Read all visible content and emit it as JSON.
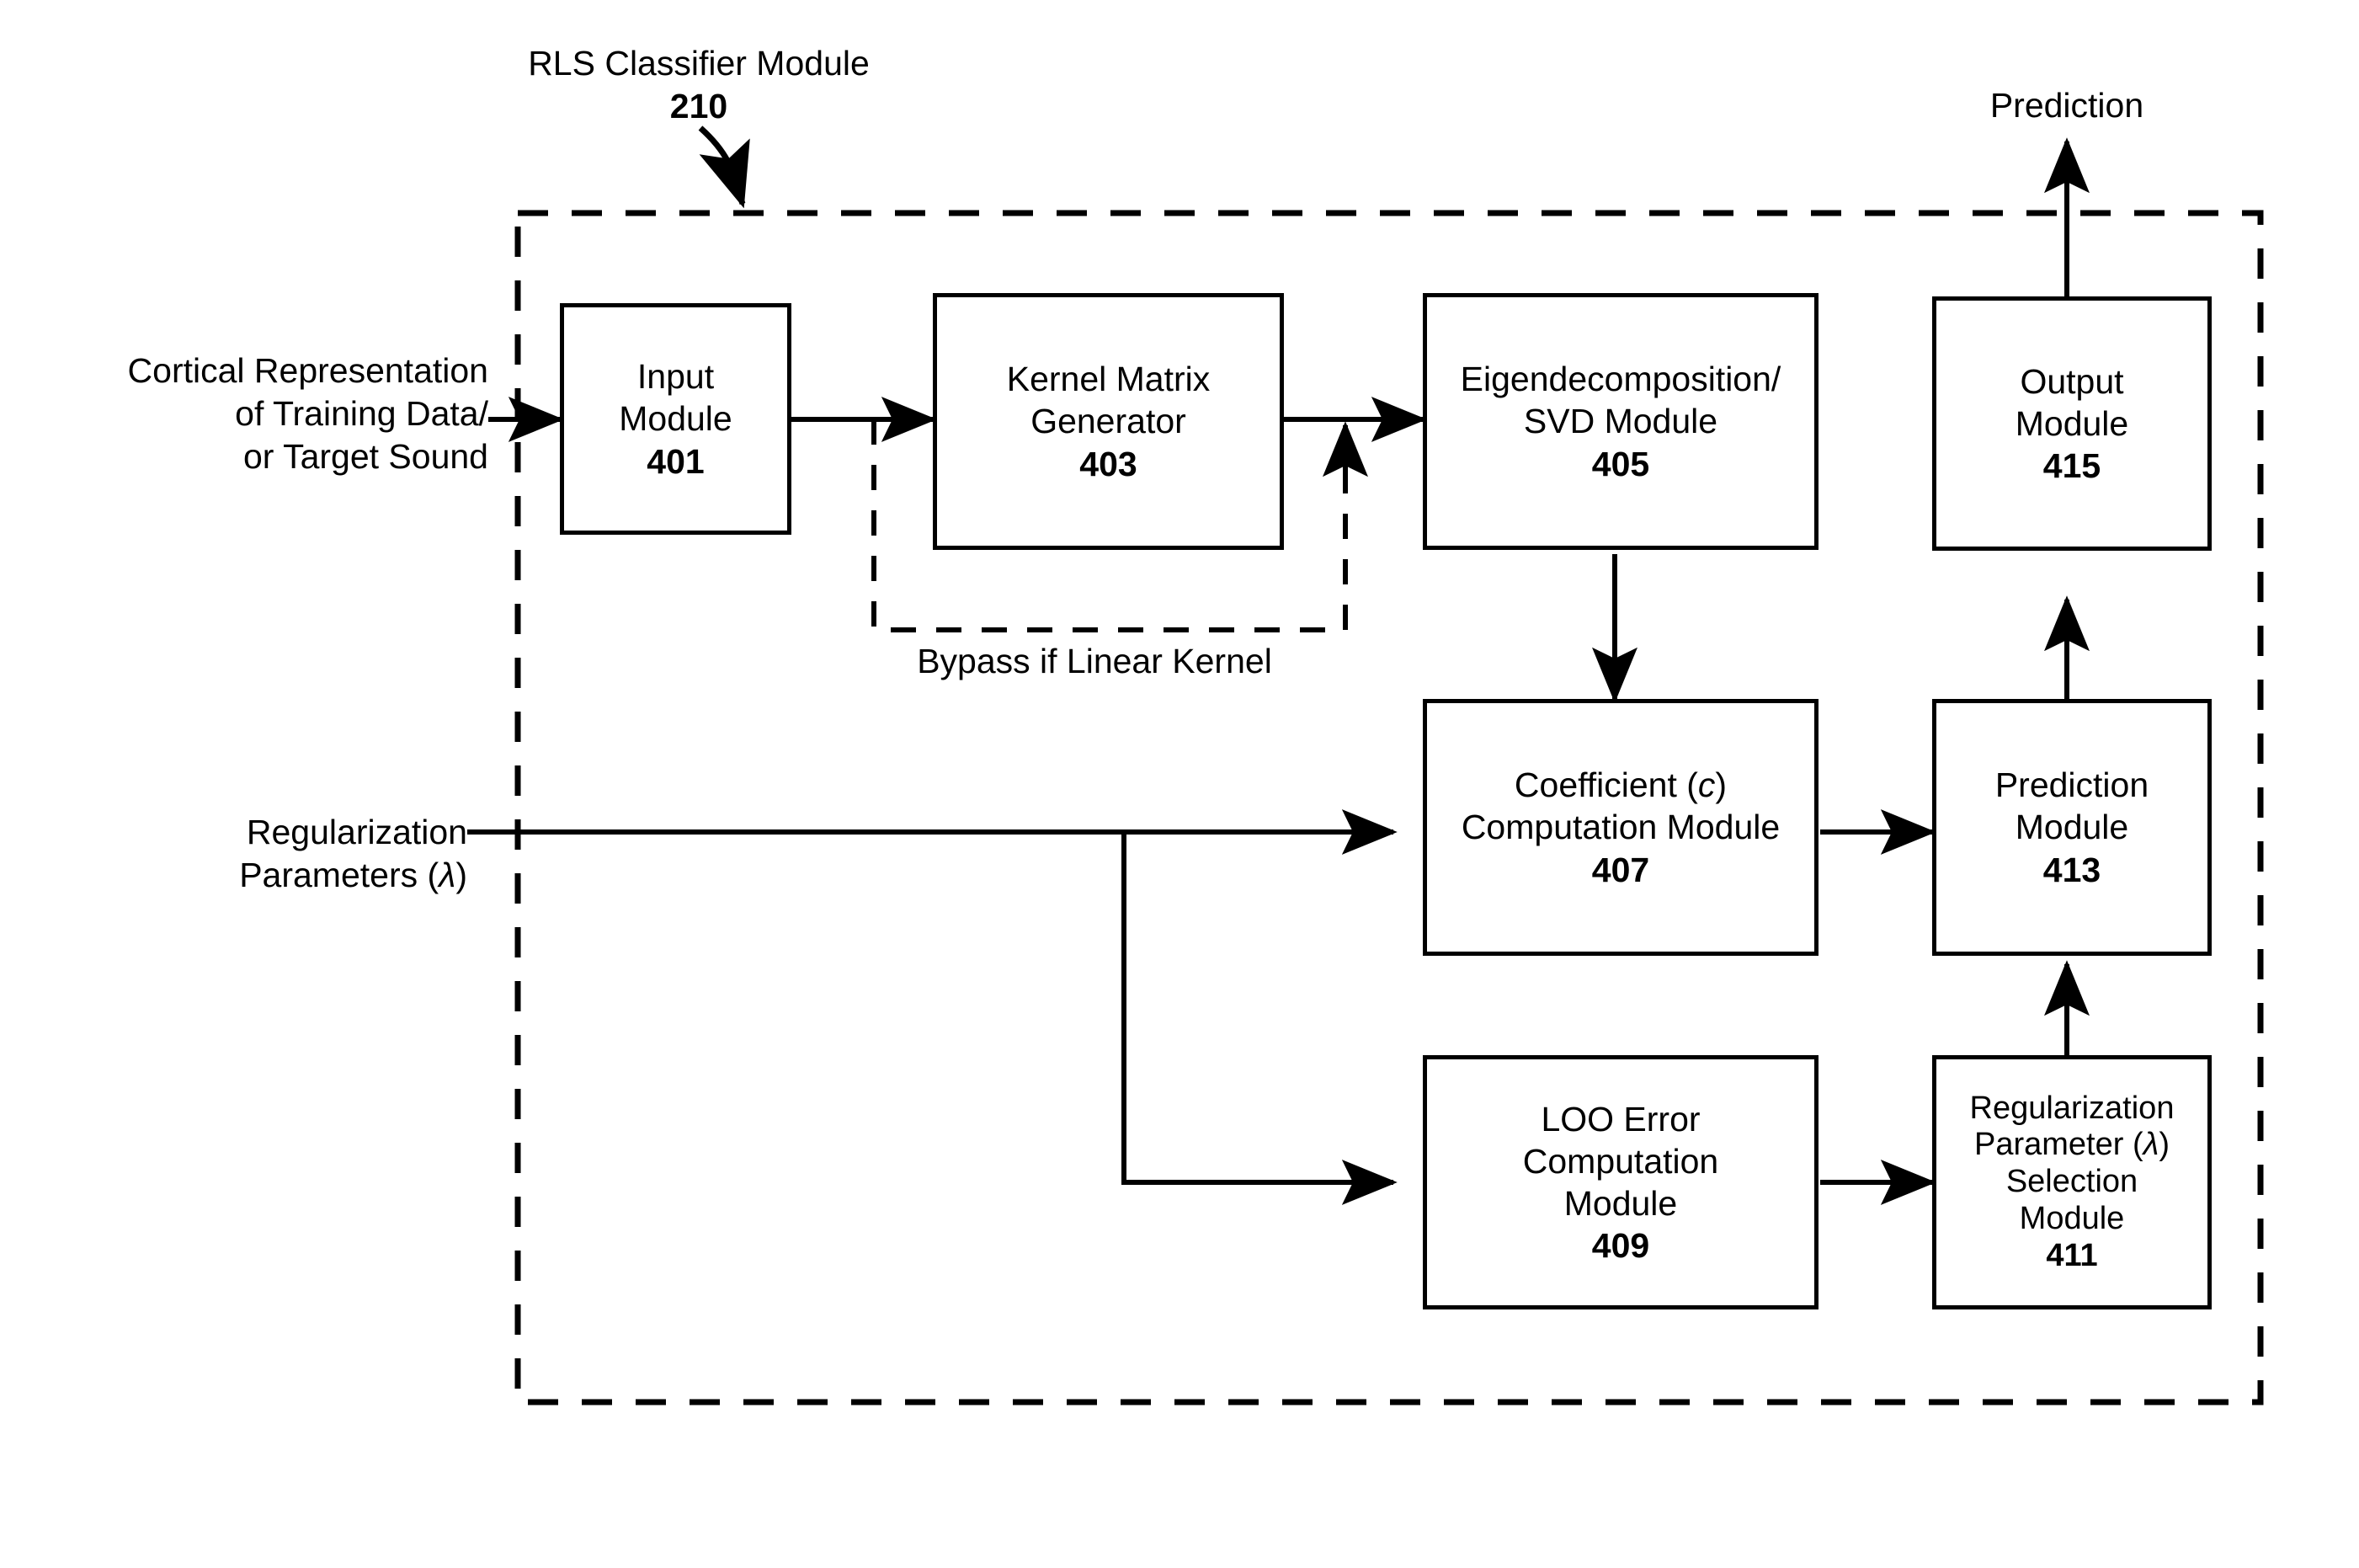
{
  "figure": {
    "title": "RLS Classifier Module",
    "title_ref": "210",
    "boundary_style": "dashed"
  },
  "inputs": {
    "cortical_label_line1": "Cortical Representation",
    "cortical_label_line2": "of Training Data/",
    "cortical_label_line3": "or Target Sound",
    "regularization_label_line1": "Regularization",
    "regularization_label_line2": "Parameters (λ)"
  },
  "outputs": {
    "prediction_label": "Prediction"
  },
  "annotations": {
    "bypass_label": "Bypass if Linear Kernel"
  },
  "modules": [
    {
      "id": "input",
      "line1": "Input",
      "line2": "Module",
      "ref": "401"
    },
    {
      "id": "kernel",
      "line1": "Kernel Matrix",
      "line2": "Generator",
      "ref": "403"
    },
    {
      "id": "eigen",
      "line1": "Eigendecomposition/",
      "line2": "SVD Module",
      "ref": "405"
    },
    {
      "id": "output",
      "line1": "Output",
      "line2": "Module",
      "ref": "415"
    },
    {
      "id": "coefficient",
      "line1": "Coefficient (c)",
      "line2": "Computation Module",
      "ref": "407"
    },
    {
      "id": "prediction",
      "line1": "Prediction",
      "line2": "Module",
      "ref": "413"
    },
    {
      "id": "loo",
      "line1": "LOO Error",
      "line2": "Computation",
      "line3": "Module",
      "ref": "409"
    },
    {
      "id": "regsel",
      "line1": "Regularization",
      "line2": "Parameter (λ)",
      "line3": "Selection",
      "line4": "Module",
      "ref": "411"
    }
  ],
  "colors": {
    "stroke": "#000000",
    "background": "#ffffff"
  }
}
